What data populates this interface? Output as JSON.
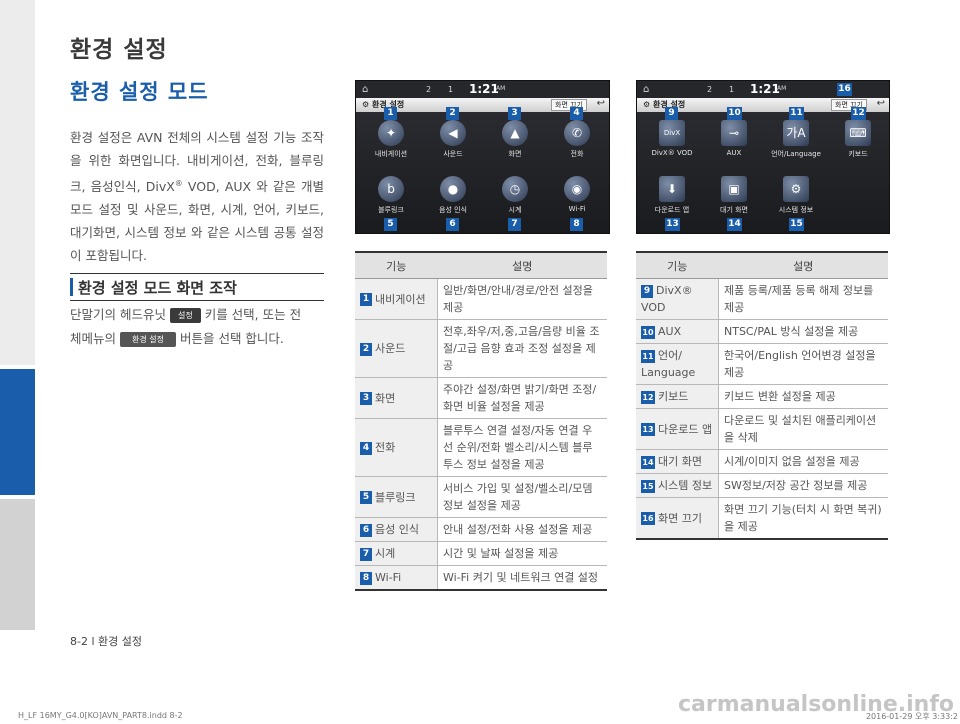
{
  "page": {
    "title": "환경 설정",
    "section_title": "환경 설정 모드",
    "intro_parts": [
      "환경 설정은 AVN 전체의 시스템 설정 기능 조작을 위한 화면입니다. 내비게이션, 전화, 블루링크, 음성인식, DivX",
      "®",
      " VOD, AUX 와 같은 개별모드 설정 및 사운드, 화면, 시계, 언어, 키보드, 대기화면, 시스템 정보 와 같은 시스템 공통 설정이 포함됩니다."
    ],
    "subsection_title": "환경 설정 모드 화면 조작",
    "ops": {
      "line1_pre": "단말기의 헤드유닛",
      "chip1": "설정",
      "line1_post": "키를 선택, 또는 전",
      "line2_pre": "체메뉴의",
      "chip2": "환경 설정",
      "line2_post": "버튼을 선택 합니다."
    },
    "footer": "8-2 l 환경 설정",
    "imprint_left": "H_LF 16MY_G4.0[KO]AVN_PART8.indd   8-2",
    "imprint_right": "2016-01-29   오후 3:33:2",
    "watermark": "carmanualsonline.info"
  },
  "screen1": {
    "status_left": "2",
    "status_mid": "1",
    "clock": "1:21",
    "clock_ampm": "AM",
    "title": "환경 설정",
    "close_btn": "화면 끄기",
    "tiles": [
      {
        "n": "1",
        "label": "내비게이션",
        "icon": "compass-icon",
        "glyph": "✦"
      },
      {
        "n": "2",
        "label": "사운드",
        "icon": "speaker-icon",
        "glyph": "◀"
      },
      {
        "n": "3",
        "label": "화면",
        "icon": "display-icon",
        "glyph": "▲"
      },
      {
        "n": "4",
        "label": "전화",
        "icon": "phone-icon",
        "glyph": "✆"
      },
      {
        "n": "5",
        "label": "블루링크",
        "icon": "bluelink-icon",
        "glyph": "b"
      },
      {
        "n": "6",
        "label": "음성 인식",
        "icon": "microphone-icon",
        "glyph": "●"
      },
      {
        "n": "7",
        "label": "시계",
        "icon": "clock-icon",
        "glyph": "◷"
      },
      {
        "n": "8",
        "label": "Wi-Fi",
        "icon": "wifi-icon",
        "glyph": "◉"
      }
    ]
  },
  "screen2": {
    "status_left": "2",
    "status_mid": "1",
    "clock": "1:21",
    "clock_ampm": "AM",
    "title": "환경 설정",
    "close_btn": "화면 끄기",
    "close_n": "16",
    "tiles": [
      {
        "n": "9",
        "label": "DivX® VOD",
        "icon": "divx-icon",
        "glyph": "DivX"
      },
      {
        "n": "10",
        "label": "AUX",
        "icon": "aux-icon",
        "glyph": "⊸"
      },
      {
        "n": "11",
        "label": "언어/Language",
        "icon": "language-icon",
        "glyph": "가A"
      },
      {
        "n": "12",
        "label": "키보드",
        "icon": "keyboard-icon",
        "glyph": "⌨"
      },
      {
        "n": "13",
        "label": "다운로드 앱",
        "icon": "download-icon",
        "glyph": "⬇"
      },
      {
        "n": "14",
        "label": "대기 화면",
        "icon": "standby-icon",
        "glyph": "▣"
      },
      {
        "n": "15",
        "label": "시스템 정보",
        "icon": "gear-icon",
        "glyph": "⚙"
      }
    ]
  },
  "table1": {
    "headers": [
      "기능",
      "설명"
    ],
    "rows": [
      {
        "n": "1",
        "name": "내비게이션",
        "desc": "일반/화면/안내/경로/안전 설정을 제공"
      },
      {
        "n": "2",
        "name": "사운드",
        "desc": "전후,좌우/저,중,고음/음량 비율 조절/고급 음향 효과 조정 설정을 제공"
      },
      {
        "n": "3",
        "name": "화면",
        "desc": "주야간 설정/화면 밝기/화면 조정/화면 비율 설정을 제공"
      },
      {
        "n": "4",
        "name": "전화",
        "desc": "블루투스 연결 설정/자동 연결 우선 순위/전화 벨소리/시스템 블루투스 정보 설정을 제공"
      },
      {
        "n": "5",
        "name": "블루링크",
        "desc": "서비스 가입 및 설정/벨소리/모뎀정보 설정을 제공"
      },
      {
        "n": "6",
        "name": "음성 인식",
        "desc": "안내 설정/전화 사용 설정을 제공"
      },
      {
        "n": "7",
        "name": "시계",
        "desc": "시간 및 날짜 설정을 제공"
      },
      {
        "n": "8",
        "name": "Wi-Fi",
        "desc": "Wi-Fi 켜기 및 네트워크 연결 설정"
      }
    ]
  },
  "table2": {
    "headers": [
      "기능",
      "설명"
    ],
    "rows": [
      {
        "n": "9",
        "name": "DivX® VOD",
        "desc": "제품 등록/제품 등록 해제 정보를 제공"
      },
      {
        "n": "10",
        "name": "AUX",
        "desc": "NTSC/PAL 방식 설정을 제공"
      },
      {
        "n": "11",
        "name": "언어/ Language",
        "desc": "한국어/English 언어변경 설정을 제공"
      },
      {
        "n": "12",
        "name": "키보드",
        "desc": "키보드 변환 설정을 제공"
      },
      {
        "n": "13",
        "name": "다운로드 앱",
        "desc": "다운로드 및 설치된 애플리케이션을 삭제"
      },
      {
        "n": "14",
        "name": "대기 화면",
        "desc": "시계/이미지 없음 설정을 제공"
      },
      {
        "n": "15",
        "name": "시스템 정보",
        "desc": "SW정보/저장 공간 정보를 제공"
      },
      {
        "n": "16",
        "name": "화면 끄기",
        "desc": "화면 끄기 기능(터치 시 화면 복귀)을 제공"
      }
    ]
  }
}
